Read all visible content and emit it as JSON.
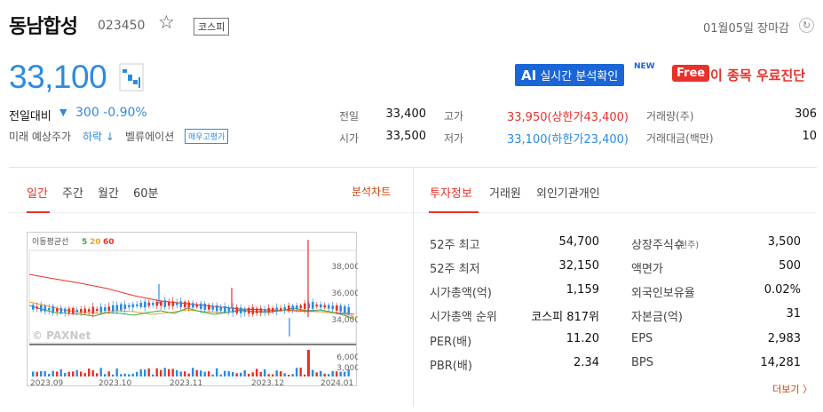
{
  "header": {
    "name": "동남합성",
    "code": "023450",
    "market": "코스피",
    "update_time": "01월05일 장마감"
  },
  "price": {
    "current": "33,100",
    "change_label": "전일대비",
    "change_arrow": "▼",
    "change_value": "300 -0.90%"
  },
  "promo": {
    "ai_prefix": "AI",
    "ai_label": "실시간 분석확인",
    "new_badge": "NEW",
    "free_badge": "Free",
    "free_label": "이 종목 우료진단"
  },
  "forecast": {
    "label": "미래 예상주가",
    "value": "하락 ↓",
    "valuation_label": "벨류에이션",
    "valuation_badge": "매우고평가"
  },
  "quote": {
    "prev_label": "전일",
    "prev_value": "33,400",
    "high_label": "고가",
    "high_value": "33,950(상한가43,400)",
    "volume_label": "거래량(주)",
    "volume_value": "306",
    "open_label": "시가",
    "open_value": "33,500",
    "low_label": "저가",
    "low_value": "33,100(하한가23,400)",
    "amount_label": "거래대금(백만)",
    "amount_value": "10"
  },
  "chart_tabs": [
    "일간",
    "주간",
    "월간",
    "60분"
  ],
  "analysis_chart": "분석차트",
  "info_tabs": [
    "투자정보",
    "거래원",
    "외인기관개인"
  ],
  "chart": {
    "ma_label": "이동평균선",
    "ma_5": "5",
    "ma_20": "20",
    "ma_60": "60",
    "watermark": "© PAXNet",
    "price_ticks": [
      "38,000",
      "36,000",
      "34,000"
    ],
    "volume_ticks": [
      "6,000",
      "3,000"
    ],
    "date_ticks": [
      "2023.09",
      "2023.10",
      "2023.11",
      "2023.12",
      "2024.01"
    ],
    "colors": {
      "up": "#e8312a",
      "down": "#2d8be0",
      "ma5": "#3aa84a",
      "ma20": "#f3a21b",
      "ma60": "#e8312a"
    }
  },
  "info": {
    "rows": [
      {
        "l1": "52주 최고",
        "v1": "54,700",
        "l2": "상장주식수",
        "l2s": "(천주)",
        "v2": "3,500"
      },
      {
        "l1": "52주 최저",
        "v1": "32,150",
        "l2": "액면가",
        "l2s": "",
        "v2": "500"
      },
      {
        "l1": "시가총액(억)",
        "v1": "1,159",
        "l2": "외국인보유율",
        "l2s": "",
        "v2": "0.02%"
      },
      {
        "l1": "시가총액 순위",
        "v1": "코스피 817위",
        "l2": "자본금(억)",
        "l2s": "",
        "v2": "31"
      },
      {
        "l1": "PER(배)",
        "v1": "11.20",
        "l2": "EPS",
        "l2s": "",
        "v2": "2,983"
      },
      {
        "l1": "PBR(배)",
        "v1": "2.34",
        "l2": "BPS",
        "l2s": "",
        "v2": "14,281"
      }
    ],
    "more": "더보기 〉"
  }
}
